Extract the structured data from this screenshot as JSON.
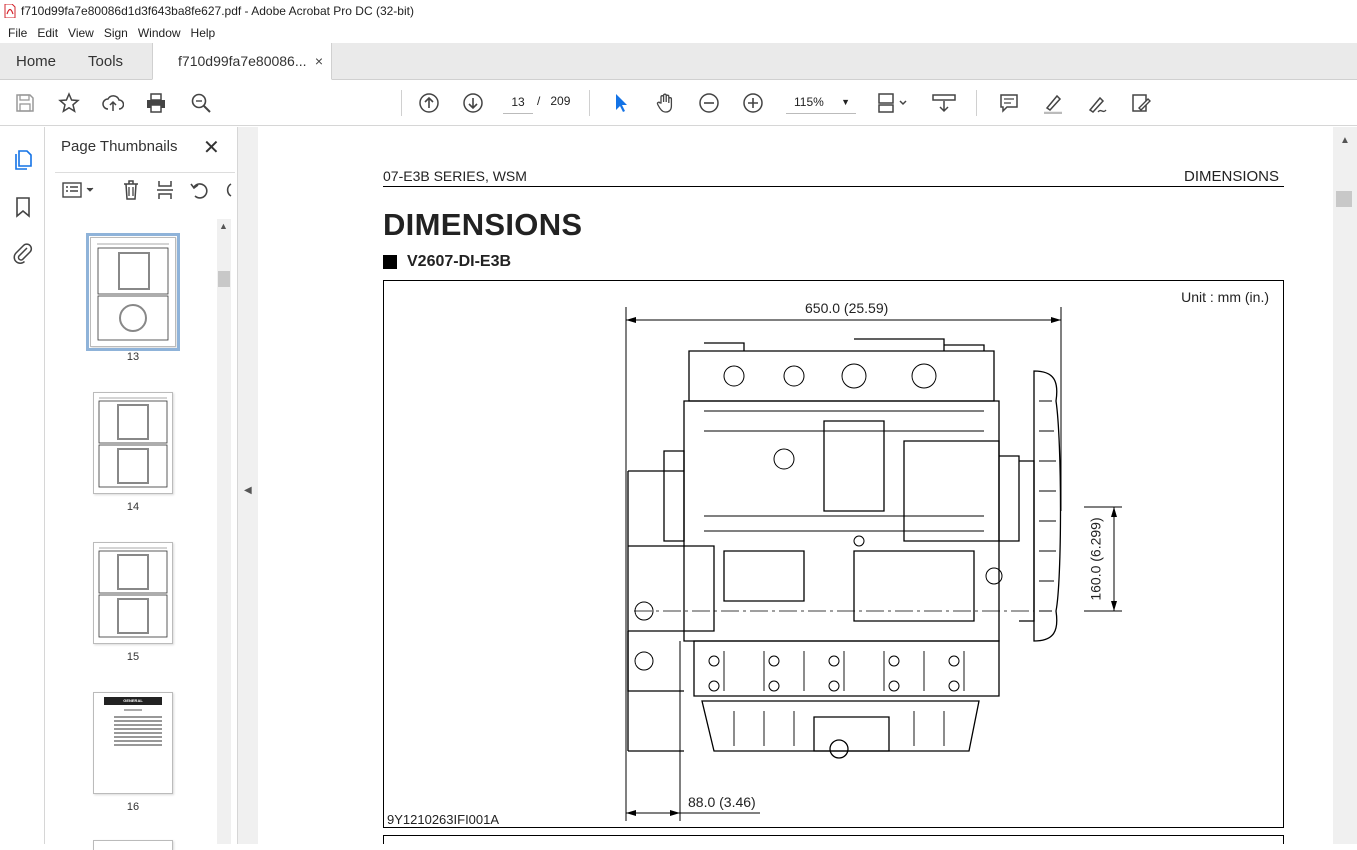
{
  "window": {
    "title": "f710d99fa7e80086d1d3f643ba8fe627.pdf - Adobe Acrobat Pro DC (32-bit)"
  },
  "menu": {
    "items": [
      "File",
      "Edit",
      "View",
      "Sign",
      "Window",
      "Help"
    ]
  },
  "tabs": {
    "home": "Home",
    "tools": "Tools",
    "doc": "f710d99fa7e80086...",
    "close": "×"
  },
  "toolbar": {
    "icons": [
      "save-icon",
      "star-icon",
      "upload-icon",
      "print-icon",
      "zoom-search-icon",
      "page-up-icon",
      "page-down-icon",
      "select-arrow-icon",
      "hand-icon",
      "zoom-out-icon",
      "zoom-in-icon",
      "fit-page-icon",
      "scroll-mode-icon",
      "comment-icon",
      "highlight-icon",
      "sign-icon",
      "edit-pdf-icon"
    ],
    "current_page": "13",
    "page_sep": "/",
    "total_pages": "209",
    "zoom": "115%"
  },
  "thumbnails": {
    "title": "Page Thumbnails",
    "close": "✕",
    "pages": [
      {
        "label": "13",
        "selected": true
      },
      {
        "label": "14",
        "selected": false
      },
      {
        "label": "15",
        "selected": false
      },
      {
        "label": "16",
        "selected": false
      }
    ],
    "p16_heading": "GENERAL"
  },
  "document": {
    "header_left": "07-E3B SERIES, WSM",
    "header_right": "DIMENSIONS",
    "title": "DIMENSIONS",
    "subtitle": "V2607-DI-E3B",
    "figure": {
      "unit": "Unit : mm (in.)",
      "dim_width": "650.0 (25.59)",
      "dim_height": "160.0 (6.299)",
      "dim_offset": "88.0 (3.46)",
      "code": "9Y1210263IFI001A"
    }
  },
  "colors": {
    "accent": "#1473e6",
    "selection": "#8fb3d9",
    "pdf_red": "#d3242c"
  }
}
